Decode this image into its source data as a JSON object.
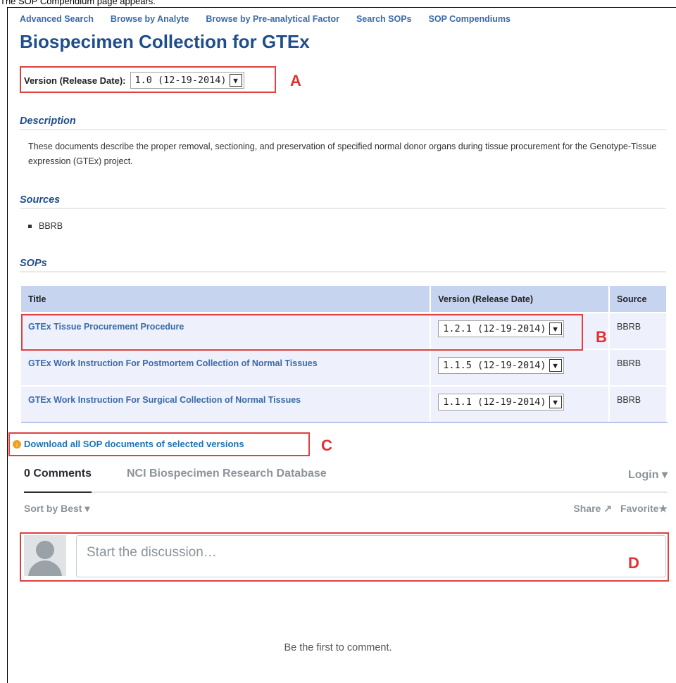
{
  "caption": "The SOP Compendium page appears.",
  "nav": {
    "items": [
      "Advanced Search",
      "Browse by Analyte",
      "Browse by Pre-analytical Factor",
      "Search SOPs",
      "SOP Compendiums"
    ]
  },
  "page_title": "Biospecimen Collection for GTEx",
  "version": {
    "label": "Version (Release Date):",
    "selected": "1.0 (12-19-2014)"
  },
  "callouts": {
    "a": "A",
    "b": "B",
    "c": "C",
    "d": "D"
  },
  "description": {
    "heading": "Description",
    "text": "These documents describe the proper removal, sectioning, and preservation of specified normal donor organs during tissue procurement for the Genotype-Tissue expression (GTEx) project."
  },
  "sources": {
    "heading": "Sources",
    "items": [
      "BBRB"
    ]
  },
  "sops": {
    "heading": "SOPs",
    "columns": [
      "Title",
      "Version (Release Date)",
      "Source"
    ],
    "rows": [
      {
        "title": "GTEx Tissue Procurement Procedure",
        "version": "1.2.1 (12-19-2014)",
        "source": "BBRB"
      },
      {
        "title": "GTEx Work Instruction For Postmortem Collection of Normal Tissues",
        "version": "1.1.5 (12-19-2014)",
        "source": "BBRB"
      },
      {
        "title": "GTEx Work Instruction For Surgical Collection of Normal Tissues",
        "version": "1.1.1 (12-19-2014)",
        "source": "BBRB"
      }
    ]
  },
  "download": {
    "label": "Download all SOP documents of selected versions",
    "icon": "download-circle-icon"
  },
  "comments": {
    "count_label": "0 Comments",
    "site_name": "NCI Biospecimen Research Database",
    "login_label": "Login",
    "sort_label": "Sort by Best",
    "share_label": "Share",
    "favorite_label": "Favorite",
    "placeholder": "Start the discussion…",
    "empty_message": "Be the first to comment."
  },
  "colors": {
    "accent": "#1f4e8c",
    "link": "#3a6aa8",
    "callout": "#e04040",
    "table_header": "#c7d4f0"
  }
}
